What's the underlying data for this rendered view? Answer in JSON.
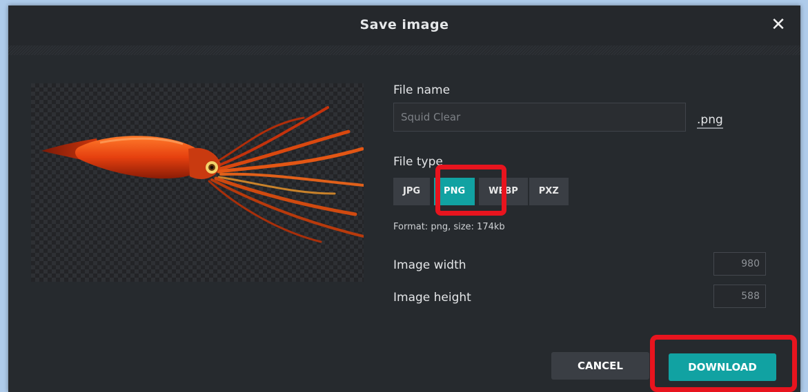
{
  "dialog": {
    "title": "Save image",
    "close_label": "✕"
  },
  "form": {
    "file_name_label": "File name",
    "file_name_value": "Squid Clear",
    "extension": ".png",
    "file_type_label": "File type",
    "file_types": [
      {
        "label": "JPG",
        "active": false
      },
      {
        "label": "PNG",
        "active": true
      },
      {
        "label": "WEBP",
        "active": false
      },
      {
        "label": "PXZ",
        "active": false
      }
    ],
    "format_info": "Format: png, size: 174kb",
    "width_label": "Image width",
    "width_value": "980",
    "height_label": "Image height",
    "height_value": "588"
  },
  "actions": {
    "cancel_label": "CANCEL",
    "download_label": "DOWNLOAD"
  },
  "colors": {
    "accent": "#11a2a2",
    "highlight": "#e8141e",
    "dialog_bg": "#262a2e"
  }
}
